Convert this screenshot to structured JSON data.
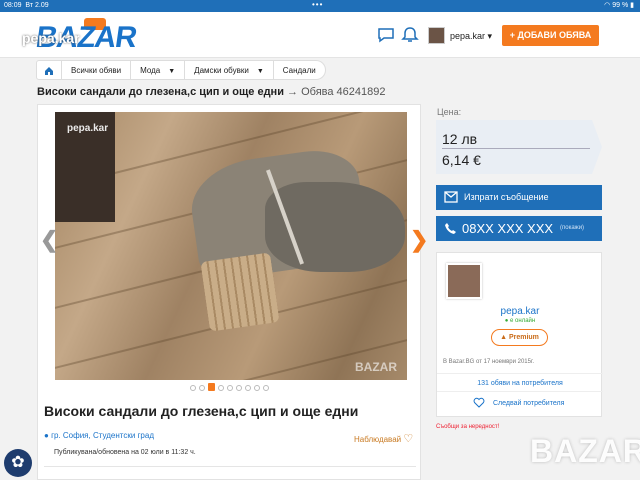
{
  "status_bar": {
    "time": "08:09",
    "date": "Вт 2.09",
    "dots": "•••",
    "battery": "99 %"
  },
  "header": {
    "logo_text": "BAZAR",
    "watermark_user": "pepa.kar",
    "username": "pepa.kar",
    "add_button": "+ ДОБАВИ ОБЯВА"
  },
  "breadcrumb": {
    "items": [
      "Всички обяви",
      "Мода",
      "Дамски обувки",
      "Сандали"
    ]
  },
  "page": {
    "title": "Високи сандали до глезена,с цип и още едни",
    "ad_ref": "→ Обява 46241892"
  },
  "listing": {
    "photo_watermark": "pepa.kar",
    "photo_brand": "BAZAR",
    "title": "Високи сандали до глезена,с цип и още едни",
    "location": "гр. София, Студентски град",
    "watch_label": "Наблюдавай",
    "published": "Публикувана/обновена на 02 юли в 11:32 ч.",
    "slide_count": 9,
    "active_slide": 3
  },
  "price": {
    "label": "Цена:",
    "bgn": "12 лв",
    "eur": "6,14 €"
  },
  "contact": {
    "message_button": "Изпрати съобщение",
    "phone": "08XX XXX XXX",
    "phone_hint": "(покажи)"
  },
  "seller": {
    "name": "pepa.kar",
    "online": "● е онлайн",
    "badge": "Premium",
    "since": "В Bazar.BG от 17 ноември 2015г.",
    "listings_link": "131 обяви на потребителя",
    "follow_link": "Следвай потребителя"
  },
  "report_link": "Съобщи за нередност!",
  "brand_watermark": "BAZAR",
  "colors": {
    "primary": "#1f6fb8",
    "accent": "#f47a1f",
    "link": "#1a73c9"
  }
}
